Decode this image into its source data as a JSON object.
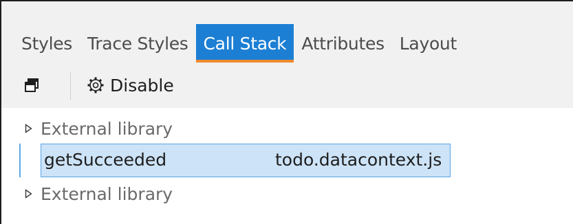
{
  "tabs": [
    {
      "label": "Styles",
      "active": false
    },
    {
      "label": "Trace Styles",
      "active": false
    },
    {
      "label": "Call Stack",
      "active": true
    },
    {
      "label": "Attributes",
      "active": false
    },
    {
      "label": "Layout",
      "active": false
    }
  ],
  "toolbar": {
    "copy_icon": "windows-stack-icon",
    "disable_icon": "gear-icon",
    "disable_label": "Disable"
  },
  "call_stack": {
    "frames": [
      {
        "kind": "group",
        "label": "External library",
        "expanded": false
      },
      {
        "kind": "frame",
        "function": "getSucceeded",
        "file": "todo.datacontext.js",
        "selected": true
      },
      {
        "kind": "group",
        "label": "External library",
        "expanded": false
      }
    ]
  },
  "colors": {
    "active_tab_bg": "#1c7fd4",
    "active_tab_underline": "#f08a2d",
    "selection_bg": "#cde3f7",
    "selection_border": "#56a3e6",
    "header_bg": "#f1f1f1"
  }
}
